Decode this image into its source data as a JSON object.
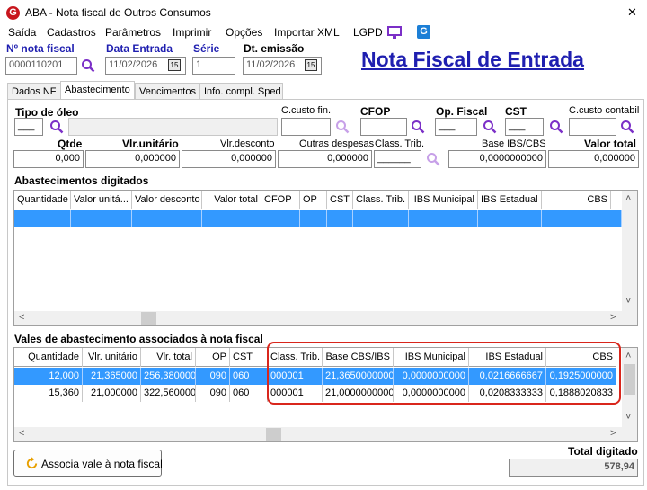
{
  "window": {
    "title": "ABA - Nota fiscal de Outros Consumos",
    "close": "✕"
  },
  "menu": {
    "items": [
      "Saída",
      "Cadastros",
      "Parâmetros",
      "Imprimir",
      "Opções",
      "Importar XML",
      "LGPD"
    ]
  },
  "header": {
    "num_label": "Nº nota fiscal",
    "num_value": "0000110201",
    "data_entrada_label": "Data Entrada",
    "data_entrada_value": "11/02/2026",
    "serie_label": "Série",
    "serie_value": "1",
    "dt_emissao_label": "Dt. emissão",
    "dt_emissao_value": "11/02/2026",
    "big_title": "Nota Fiscal de Entrada",
    "calendar_glyph": "15"
  },
  "tabs": [
    "Dados NF",
    "Abastecimento",
    "Vencimentos",
    "Info. compl. Sped"
  ],
  "form": {
    "tipo_oleo_label": "Tipo de óleo",
    "tipo_oleo_value": "___",
    "ccusto_fin_label": "C.custo fin.",
    "cfop_label": "CFOP",
    "cfop_value": "",
    "op_fiscal_label": "Op. Fiscal",
    "op_fiscal_value": "___",
    "cst_label": "CST",
    "cst_value": "___",
    "ccusto_contabil_label": "C.custo contabil",
    "qtde_label": "Qtde",
    "qtde_value": "0,000",
    "vlr_unitario_label": "Vlr.unitário",
    "vlr_unitario_value": "0,000000",
    "vlr_desconto_label": "Vlr.desconto",
    "vlr_desconto_value": "0,000000",
    "outras_despesas_label": "Outras despesas",
    "outras_despesas_value": "0,000000",
    "class_trib_label": "Class. Trib.",
    "class_trib_value": "______",
    "base_ibs_label": "Base IBS/CBS",
    "base_ibs_value": "0,0000000000",
    "valor_total_label": "Valor total",
    "valor_total_value": "0,000000"
  },
  "abastecimentos": {
    "title": "Abastecimentos digitados",
    "columns": [
      "Quantidade",
      "Valor unitá...",
      "Valor desconto",
      "Valor total",
      "CFOP",
      "OP",
      "CST",
      "Class. Trib.",
      "IBS Municipal",
      "IBS Estadual",
      "CBS"
    ]
  },
  "vales": {
    "title": "Vales de abastecimento associados à nota fiscal",
    "columns": [
      "Quantidade",
      "Vlr. unitário",
      "Vlr. total",
      "OP",
      "CST",
      "Class. Trib.",
      "Base CBS/IBS",
      "IBS Municipal",
      "IBS Estadual",
      "CBS"
    ],
    "rows": [
      [
        "12,000",
        "21,365000",
        "256,380000",
        "090",
        "060",
        "000001",
        "21,3650000000",
        "0,0000000000",
        "0,0216666667",
        "0,1925000000"
      ],
      [
        "15,360",
        "21,000000",
        "322,560000",
        "090",
        "060",
        "000001",
        "21,0000000000",
        "0,0000000000",
        "0,0208333333",
        "0,1888020833"
      ]
    ]
  },
  "associa_button": "Associa vale à nota fiscal",
  "total_label": "Total digitado",
  "total_value": "578,94",
  "colors": {
    "accent": "#1f1fb0",
    "selection": "#3399ff",
    "highlight_box": "#d9261c",
    "icon_purple": "#7b2fc7"
  }
}
